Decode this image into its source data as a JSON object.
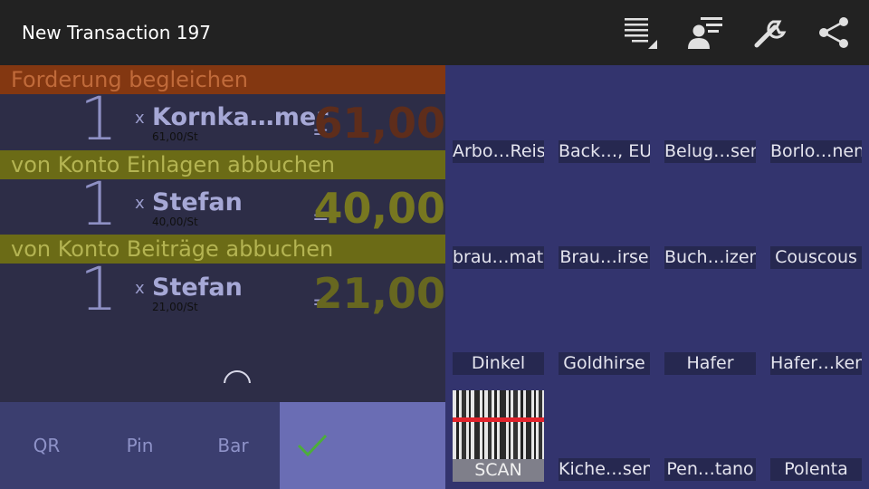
{
  "actionbar": {
    "title": "New Transaction 197",
    "icons": [
      "list-settings-icon",
      "person-list-icon",
      "wrench-icon",
      "share-icon"
    ]
  },
  "transactions": [
    {
      "header": "Forderung begleichen",
      "header_bg": "#833711",
      "header_color": "#c06a3a",
      "quantity": "1",
      "times": "x",
      "product": "Kornka…mer",
      "unit_price": "61,00/St",
      "eq": "=",
      "amount": "61,00",
      "amount_color": "#5e2d1b"
    },
    {
      "header": "von Konto Einlagen abbuchen",
      "header_bg": "#6b6b16",
      "header_color": "#b4b452",
      "quantity": "1",
      "times": "x",
      "product": "Stefan",
      "unit_price": "40,00/St",
      "eq": "=",
      "amount": "40,00",
      "amount_color": "#777720"
    },
    {
      "header": "von Konto Beiträge abbuchen",
      "header_bg": "#6b6b16",
      "header_color": "#b4b452",
      "quantity": "1",
      "times": "x",
      "product": "Stefan",
      "unit_price": "21,00/St",
      "eq": "=",
      "amount": "21,00",
      "amount_color": "#676720"
    }
  ],
  "bottombar": {
    "qr": "QR",
    "pin": "Pin",
    "bar": "Bar",
    "confirm_icon": "checkmark-icon",
    "check_color": "#4cae3a"
  },
  "products": [
    [
      "Arbo…Reis",
      "Back…, EU",
      "Belug…sen",
      "Borlo…nen"
    ],
    [
      "brau…mati",
      "Brau…irse",
      "Buch…izen",
      "Couscous"
    ],
    [
      "Dinkel",
      "Goldhirse",
      "Hafer",
      "Hafer…ken"
    ],
    [
      "SCAN",
      "Kiche…sen",
      "Pen…tano",
      "Polenta"
    ]
  ]
}
